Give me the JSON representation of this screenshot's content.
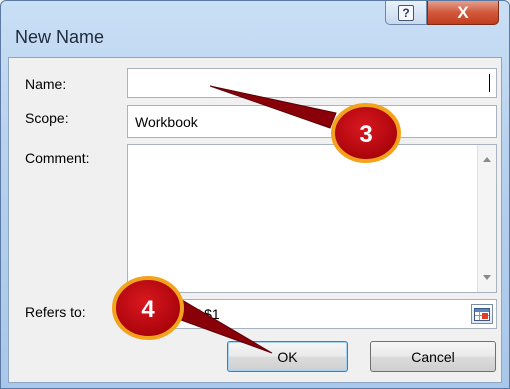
{
  "window": {
    "title": "New Name",
    "help_glyph": "?",
    "close_glyph": "X"
  },
  "form": {
    "name_label": "Name:",
    "name_value": "",
    "scope_label": "Scope:",
    "scope_value": "Workbook",
    "comment_label": "Comment:",
    "comment_value": "",
    "refers_label": "Refers to:",
    "refers_value": "$A$1"
  },
  "buttons": {
    "ok_label": "OK",
    "cancel_label": "Cancel"
  },
  "annotations": {
    "step3": "3",
    "step4": "4",
    "badge_color": "#c0000e",
    "badge_border": "#f3a21b"
  },
  "icons": [
    "help-icon",
    "close-icon",
    "scroll-up-icon",
    "scroll-down-icon",
    "collapse-dialog-icon"
  ]
}
